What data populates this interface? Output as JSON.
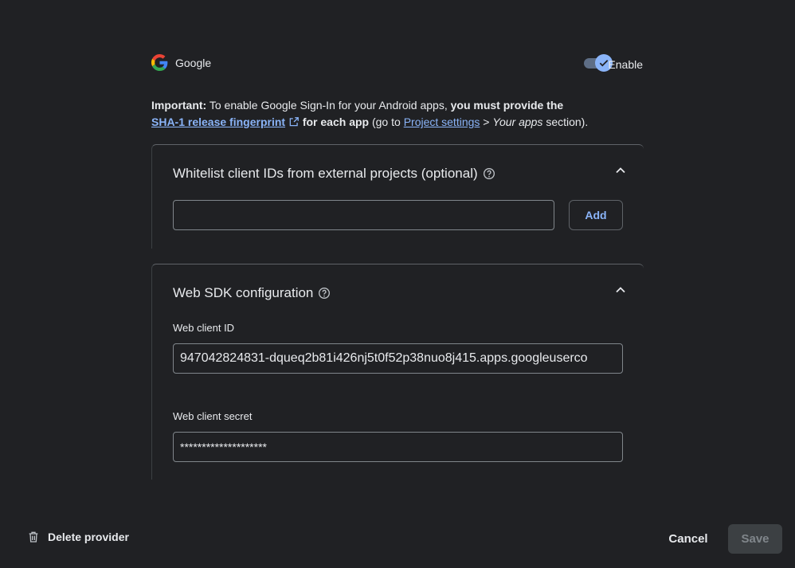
{
  "provider": {
    "name": "Google",
    "toggle_label": "Enable",
    "enabled": true
  },
  "important": {
    "lead": "Important:",
    "text1": " To enable Google Sign-In for your Android apps, ",
    "bold1": "you must provide the",
    "link1": "SHA-1 release fingerprint",
    "bold2": " for each app",
    "text2": " (go to ",
    "link2": "Project settings",
    "text3": " > ",
    "italic": "Your apps",
    "text4": " section)."
  },
  "whitelist": {
    "title": "Whitelist client IDs from external projects (optional)",
    "input_value": "",
    "add_label": "Add"
  },
  "web_sdk": {
    "title": "Web SDK configuration",
    "client_id_label": "Web client ID",
    "client_id_value": "947042824831-dqueq2b81i426nj5t0f52p38nuo8j415.apps.googleuserco",
    "client_secret_label": "Web client secret",
    "client_secret_value": "********************"
  },
  "footer": {
    "delete_label": "Delete provider",
    "cancel_label": "Cancel",
    "save_label": "Save"
  },
  "colors": {
    "accent": "#8ab4f8",
    "background": "#202124",
    "text": "#e8eaed"
  }
}
